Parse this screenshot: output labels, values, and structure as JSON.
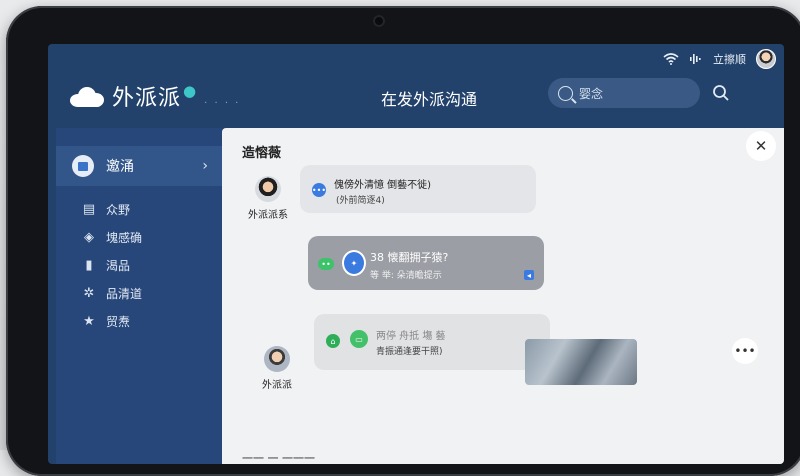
{
  "status": {
    "user_name": "立擦顺"
  },
  "header": {
    "logo_text": "外派派",
    "logo_dots": "· · · ·",
    "title": "在发外派沟通",
    "search_placeholder": "婴念"
  },
  "sidebar": {
    "active": {
      "label": "邀涌"
    },
    "items": [
      {
        "label": "众野",
        "icon": "document-icon"
      },
      {
        "label": "塊感确",
        "icon": "shield-check-icon"
      },
      {
        "label": "渴品",
        "icon": "bar-chart-icon"
      },
      {
        "label": "品清道",
        "icon": "gear-icon"
      },
      {
        "label": "贸焘",
        "icon": "star-icon"
      }
    ]
  },
  "panel": {
    "title": "造愹薇",
    "people": [
      {
        "name": "外派派系"
      },
      {
        "name": "外派派"
      }
    ],
    "messages": [
      {
        "line1": "傀傍外清憶 倒藝不徙)",
        "line2": "(外前简逐4)"
      },
      {
        "line1": "38 懐翻拥子猿?",
        "line2": "等 举: 朵清瞻提示"
      },
      {
        "line1": "两停 舟抵 塲 藝",
        "line2": "青振通逢要干照)"
      }
    ],
    "bottom_text": "一一 一 一一一"
  },
  "colors": {
    "header_bg": "#22426b",
    "sidebar_bg": "#27477a",
    "panel_bg": "#f1f2f4"
  }
}
